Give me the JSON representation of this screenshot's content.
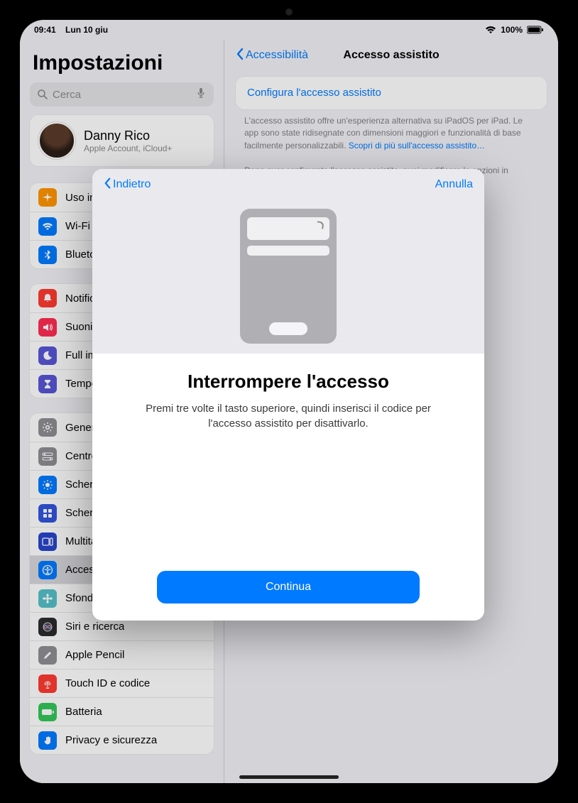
{
  "status": {
    "time": "09:41",
    "date": "Lun 10 giu",
    "battery_pct": "100%"
  },
  "sidebar": {
    "title": "Impostazioni",
    "search_placeholder": "Cerca",
    "profile": {
      "name": "Danny Rico",
      "sub": "Apple Account, iCloud+"
    },
    "group1": [
      {
        "label": "Uso in aereo",
        "icon": "airplane",
        "color": "#ff9500"
      },
      {
        "label": "Wi-Fi",
        "icon": "wifi",
        "color": "#007aff"
      },
      {
        "label": "Bluetooth",
        "icon": "bluetooth",
        "color": "#007aff"
      }
    ],
    "group2": [
      {
        "label": "Notifiche",
        "icon": "bell",
        "color": "#ff3b30"
      },
      {
        "label": "Suoni",
        "icon": "speaker",
        "color": "#ff2d55"
      },
      {
        "label": "Full immersion",
        "icon": "moon",
        "color": "#5856d6"
      },
      {
        "label": "Tempo di utilizzo",
        "icon": "hourglass",
        "color": "#5856d6"
      }
    ],
    "group3": [
      {
        "label": "Generali",
        "icon": "gear",
        "color": "#8e8e93"
      },
      {
        "label": "Centro di Controllo",
        "icon": "switches",
        "color": "#8e8e93"
      },
      {
        "label": "Schermo e luminosità",
        "icon": "brightness",
        "color": "#007aff"
      },
      {
        "label": "Schermata Home e libreria app",
        "icon": "grid",
        "color": "#3355dd"
      },
      {
        "label": "Multitasking e gesti",
        "icon": "multitask",
        "color": "#2845cc"
      },
      {
        "label": "Accessibilità",
        "icon": "accessibility",
        "color": "#007aff",
        "selected": true
      },
      {
        "label": "Sfondo",
        "icon": "flower",
        "color": "#55c1c9"
      },
      {
        "label": "Siri e ricerca",
        "icon": "siri",
        "color": "#2c2c2e"
      },
      {
        "label": "Apple Pencil",
        "icon": "pencil",
        "color": "#8e8e93"
      },
      {
        "label": "Touch ID e codice",
        "icon": "fingerprint",
        "color": "#ff3b30"
      },
      {
        "label": "Batteria",
        "icon": "battery",
        "color": "#34c759"
      },
      {
        "label": "Privacy e sicurezza",
        "icon": "hand",
        "color": "#007aff"
      }
    ]
  },
  "main": {
    "back_label": "Accessibilità",
    "title": "Accesso assistito",
    "config_link": "Configura l'accesso assistito",
    "desc1": "L'accesso assistito offre un'esperienza alternativa su iPadOS per iPad. Le app sono state ridisegnate con dimensioni maggiori e funzionalità di base facilmente personalizzabili.",
    "desc1_more": "Scopri di più sull'accesso assistito…",
    "desc2": "Dopo aver configurato l'accesso assistito, puoi modificare le opzioni in"
  },
  "modal": {
    "back": "Indietro",
    "cancel": "Annulla",
    "heading": "Interrompere l'accesso",
    "body": "Premi tre volte il tasto superiore, quindi inserisci il codice per l'accesso assistito per disattivarlo.",
    "continue": "Continua"
  }
}
